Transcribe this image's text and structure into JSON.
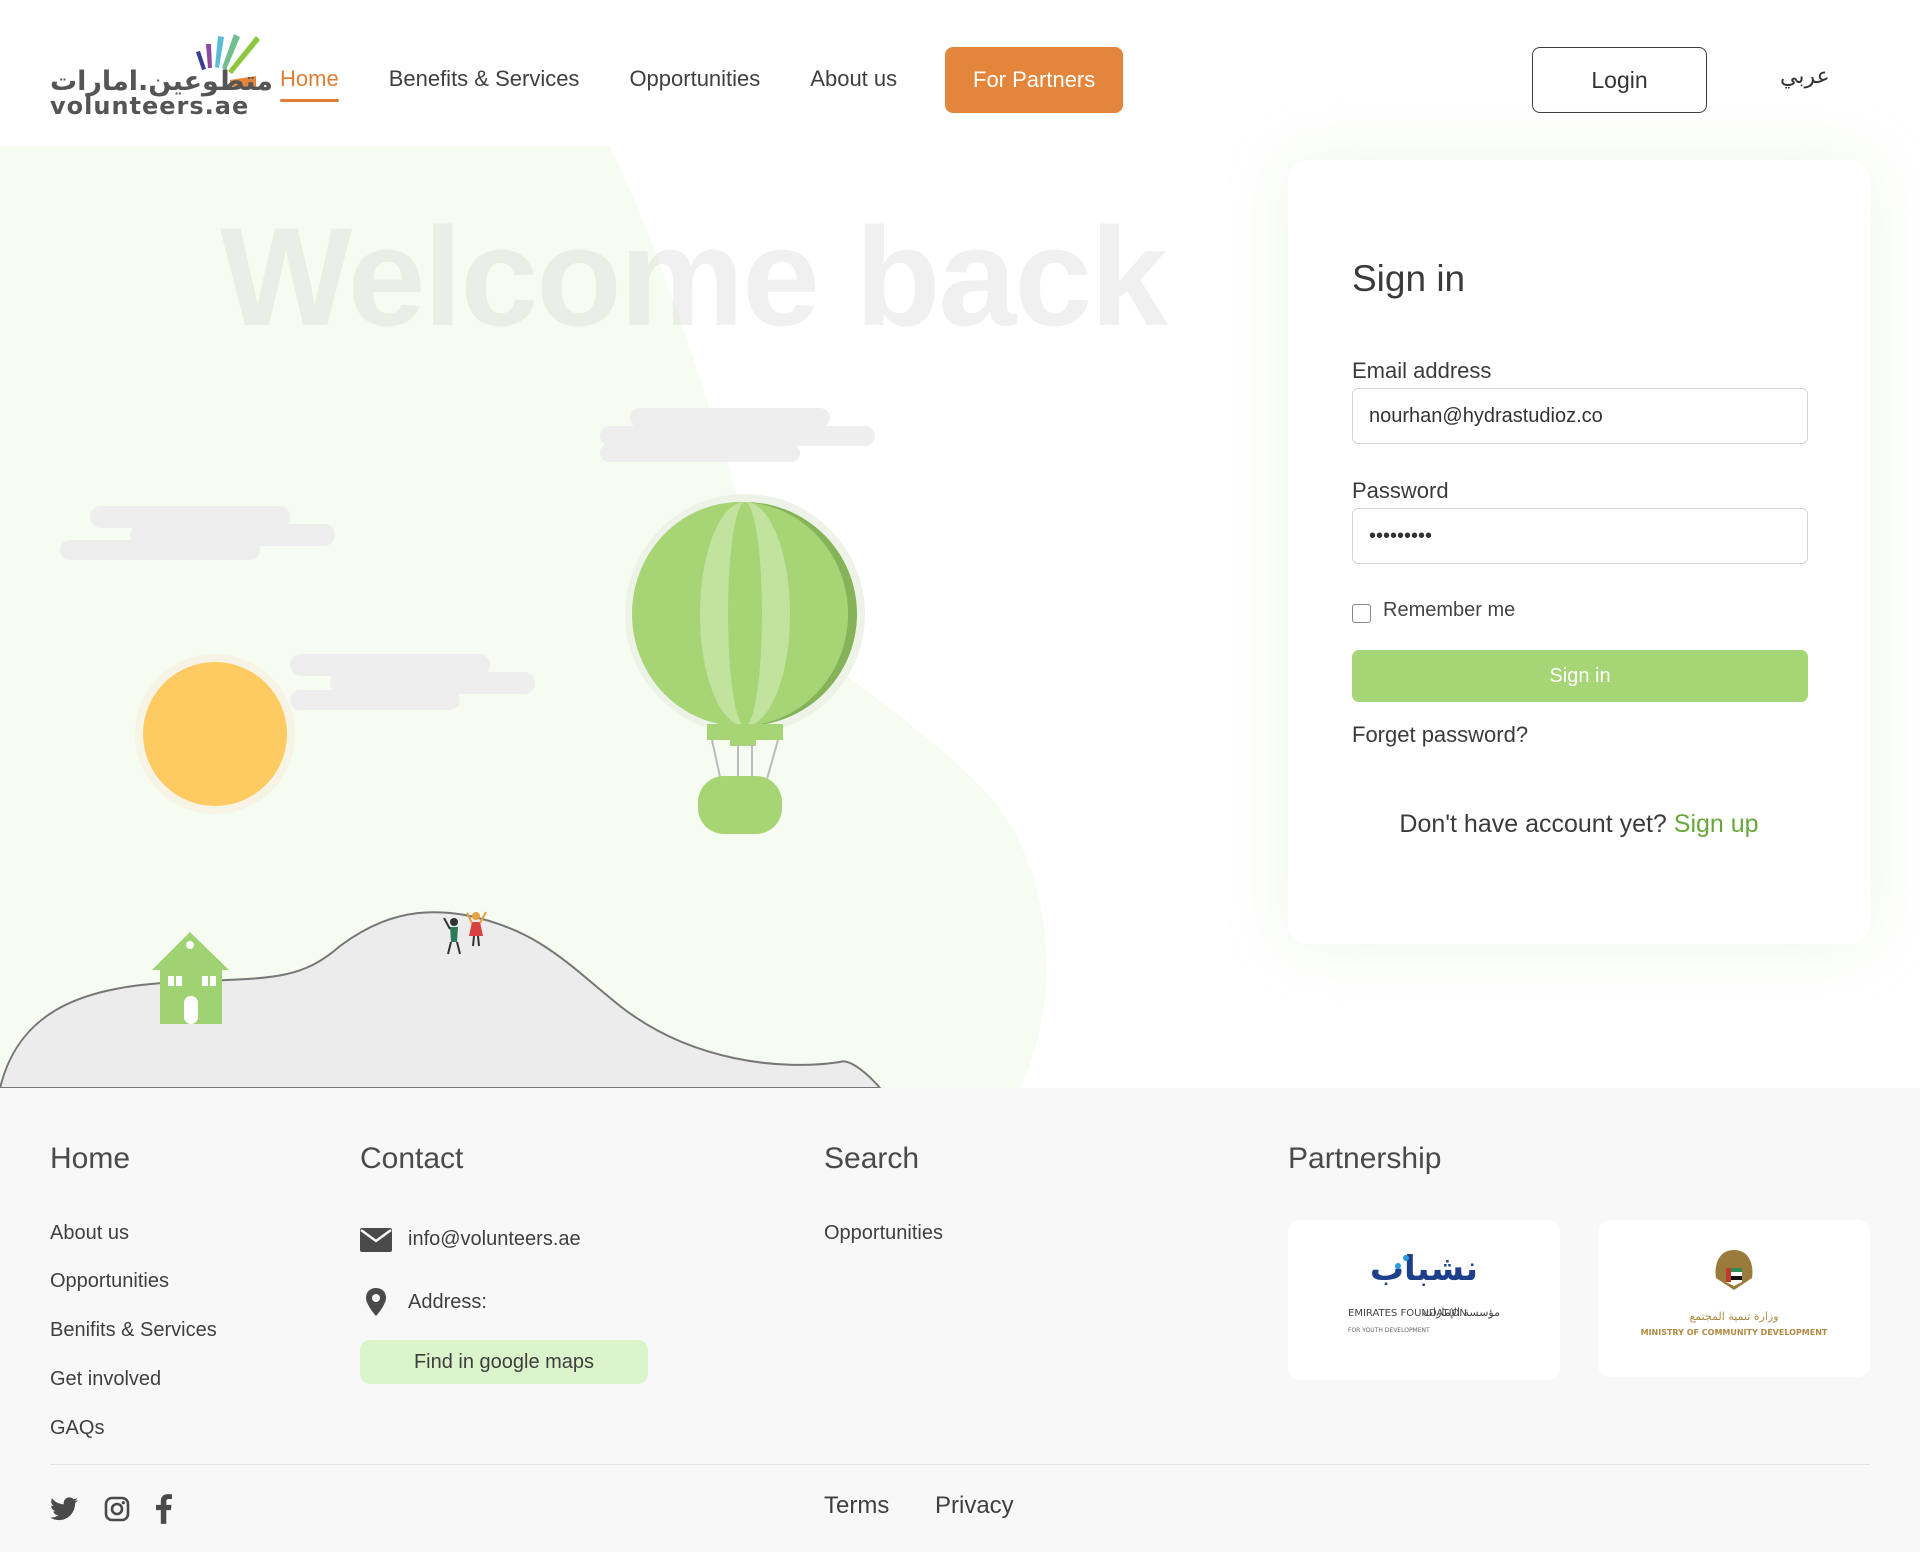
{
  "brand": {
    "arabic_name": "متطوعين.امارات",
    "latin_name": "volunteers.ae"
  },
  "nav": {
    "items": [
      {
        "label": "Home",
        "active": true
      },
      {
        "label": "Benefits & Services",
        "active": false
      },
      {
        "label": "Opportunities",
        "active": false
      },
      {
        "label": "About us",
        "active": false
      }
    ],
    "partners_button": "For Partners",
    "login_button": "Login",
    "language_link": "عربي"
  },
  "hero": {
    "welcome_text": "Welcome back"
  },
  "signin": {
    "title": "Sign in",
    "email_label": "Email address",
    "email_value": "nourhan@hydrastudioz.co",
    "password_label": "Password",
    "password_value": "•••••••••",
    "remember_label": "Remember me",
    "remember_checked": false,
    "submit_button": "Sign in",
    "forgot_link": "Forget password?",
    "signup_prompt": "Don't have account yet?",
    "signup_link": "Sign up"
  },
  "footer": {
    "home": {
      "heading": "Home",
      "links": [
        "About us",
        "Opportunities",
        "Benifits & Services",
        "Get involved",
        "GAQs"
      ]
    },
    "contact": {
      "heading": "Contact",
      "email": "info@volunteers.ae",
      "address_label": "Address:",
      "maps_button": "Find in google maps"
    },
    "search": {
      "heading": "Search",
      "links": [
        "Opportunities"
      ]
    },
    "partnership": {
      "heading": "Partnership",
      "partners": [
        {
          "latin": "EMIRATES FOUNDATION",
          "arabic": "مؤسسة الإمارات",
          "tagline": "FOR YOUTH DEVELOPMENT",
          "logo_word": "نشباب"
        },
        {
          "latin": "MINISTRY OF COMMUNITY DEVELOPMENT",
          "arabic": "وزارة تنمية المجتمع"
        }
      ]
    },
    "legal": {
      "terms": "Terms",
      "privacy": "Privacy"
    },
    "social_icons": [
      "twitter-icon",
      "instagram-icon",
      "facebook-icon"
    ]
  },
  "colors": {
    "accent_orange": "#e3853a",
    "accent_green": "#a5d574",
    "link_green": "#68a83a",
    "maps_button_bg": "#dbf4cc",
    "sun_yellow": "#fdcb62",
    "balloon_green": "#a7d576"
  }
}
